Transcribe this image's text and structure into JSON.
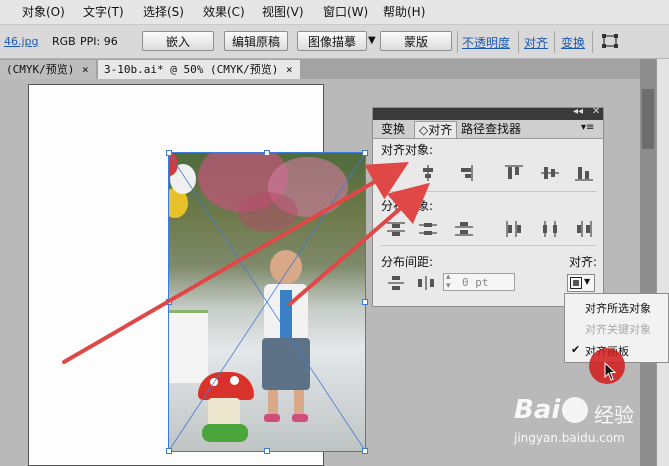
{
  "menubar": {
    "items": [
      "对象(O)",
      "文字(T)",
      "选择(S)",
      "效果(C)",
      "视图(V)",
      "窗口(W)",
      "帮助(H)"
    ]
  },
  "control_bar": {
    "filename": "46.jpg",
    "color_mode": "RGB",
    "ppi": "PPI: 96",
    "embed_button": "嵌入",
    "edit_original_button": "编辑原稿",
    "image_trace_button": "图像描摹",
    "mask_button": "蒙版",
    "opacity_link": "不透明度",
    "align_link": "对齐",
    "transform_link": "变换"
  },
  "doc_tabs": [
    {
      "label": "(CMYK/预览)",
      "close": "×"
    },
    {
      "label": "3-10b.ai* @ 50% (CMYK/预览)",
      "close": "×"
    }
  ],
  "align_panel": {
    "tabs": [
      "变换",
      "◇对齐",
      "路径查找器"
    ],
    "align_objects_label": "对齐对象:",
    "distribute_objects_label": "分布对象:",
    "distribute_spacing_label": "分布间距:",
    "align_to_label": "对齐:",
    "spacing_value": "0 pt"
  },
  "align_to_menu": {
    "items": [
      {
        "label": "对齐所选对象",
        "checked": false,
        "enabled": true
      },
      {
        "label": "对齐关键对象",
        "checked": false,
        "enabled": false
      },
      {
        "label": "对齐画板",
        "checked": true,
        "enabled": true
      }
    ],
    "check_mark": "✔"
  },
  "watermark": {
    "brand": "Bai",
    "brand_suffix": "经验",
    "url": "jingyan.baidu.com"
  },
  "colors": {
    "annotation_arrow": "#e04848",
    "selection": "#3e7bd6",
    "link": "#1d58b3",
    "cursor_highlight": "#d11a1a"
  }
}
